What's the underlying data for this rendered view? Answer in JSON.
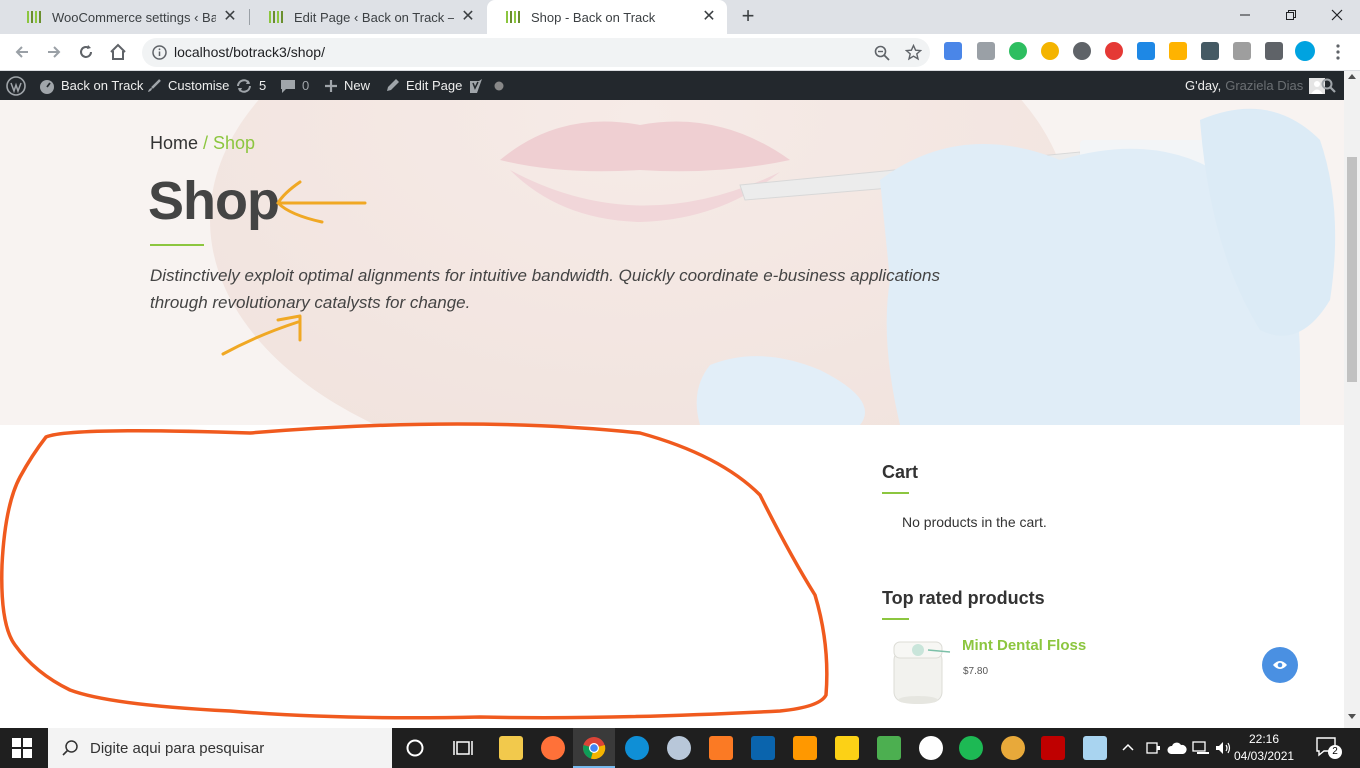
{
  "browser": {
    "tabs": [
      {
        "title": "WooCommerce settings ‹ Back on",
        "active": false
      },
      {
        "title": "Edit Page ‹ Back on Track — Word",
        "active": false
      },
      {
        "title": "Shop - Back on Track",
        "active": true
      }
    ],
    "url": "localhost/botrack3/shop/"
  },
  "admin_bar": {
    "site_name": "Back on Track",
    "customise": "Customise",
    "updates_count": "5",
    "comments_count": "0",
    "new_label": "New",
    "edit_page": "Edit Page",
    "greeting": "G'day,",
    "user_name": "Graziela Dias"
  },
  "page": {
    "breadcrumb_home": "Home",
    "breadcrumb_sep": " / ",
    "breadcrumb_current": "Shop",
    "title": "Shop",
    "tagline": "Distinctively exploit optimal alignments for intuitive bandwidth. Quickly coordinate e-business applications through revolutionary catalysts for change."
  },
  "sidebar": {
    "cart_title": "Cart",
    "cart_empty": "No products in the cart.",
    "top_rated_title": "Top rated products",
    "products": [
      {
        "name": "Mint Dental Floss",
        "price": "$7.80"
      }
    ]
  },
  "taskbar": {
    "search_placeholder": "Digite aqui para pesquisar",
    "time": "22:16",
    "date": "04/03/2021",
    "notification_count": "2"
  },
  "colors": {
    "accent_green": "#8cc63f",
    "annotation_orange": "#f0a824",
    "annotation_red": "#f05a1e",
    "admin_bar": "#23282d"
  }
}
